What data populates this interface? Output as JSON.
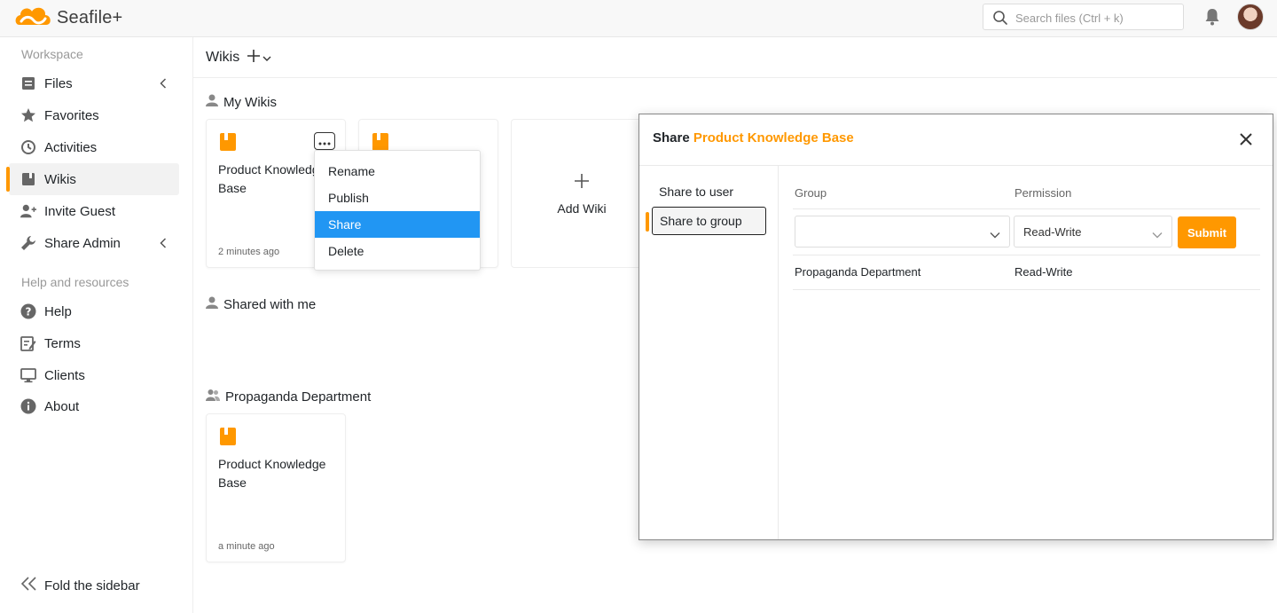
{
  "header": {
    "app_name": "Seafile+",
    "search_placeholder": "Search files (Ctrl + k)",
    "icons": [
      "cloud-logo-icon",
      "search-icon",
      "bell-icon",
      "avatar"
    ],
    "accent_color": "#ff9800"
  },
  "sidebar": {
    "workspace_heading": "Workspace",
    "items": [
      {
        "label": "Files",
        "icon": "file-icon"
      },
      {
        "label": "Favorites",
        "icon": "star-icon"
      },
      {
        "label": "Activities",
        "icon": "clock-icon"
      },
      {
        "label": "Wikis",
        "icon": "wiki-icon",
        "active": true
      },
      {
        "label": "Invite Guest",
        "icon": "invite-user-icon"
      },
      {
        "label": "Share Admin",
        "icon": "wrench-icon"
      }
    ],
    "help_heading": "Help and resources",
    "help_items": [
      {
        "label": "Help",
        "icon": "question-icon"
      },
      {
        "label": "Terms",
        "icon": "terms-icon"
      },
      {
        "label": "Clients",
        "icon": "monitor-icon"
      },
      {
        "label": "About",
        "icon": "info-icon"
      }
    ],
    "fold_label": "Fold the sidebar"
  },
  "main": {
    "title": "Wikis",
    "my_wikis": {
      "heading": "My Wikis",
      "cards": [
        {
          "name": "Product Knowledge Base",
          "time": "2 minutes ago"
        }
      ],
      "add_label": "Add Wiki"
    },
    "shared_heading": "Shared with me",
    "group_section": {
      "heading": "Propaganda Department",
      "cards": [
        {
          "name": "Product Knowledge Base",
          "time": "a minute ago"
        }
      ]
    }
  },
  "menu": {
    "items": [
      "Rename",
      "Publish",
      "Share",
      "Delete"
    ],
    "active": "Share"
  },
  "dialog": {
    "title_prefix": "Share",
    "title_name": "Product Knowledge Base",
    "nav": [
      "Share to user",
      "Share to group"
    ],
    "active_nav": "Share to group",
    "group_header": "Group",
    "permission_header": "Permission",
    "group_value": "",
    "permission_value": "Read-Write",
    "submit_label": "Submit",
    "rows": [
      {
        "group": "Propaganda Department",
        "permission": "Read-Write"
      }
    ]
  }
}
